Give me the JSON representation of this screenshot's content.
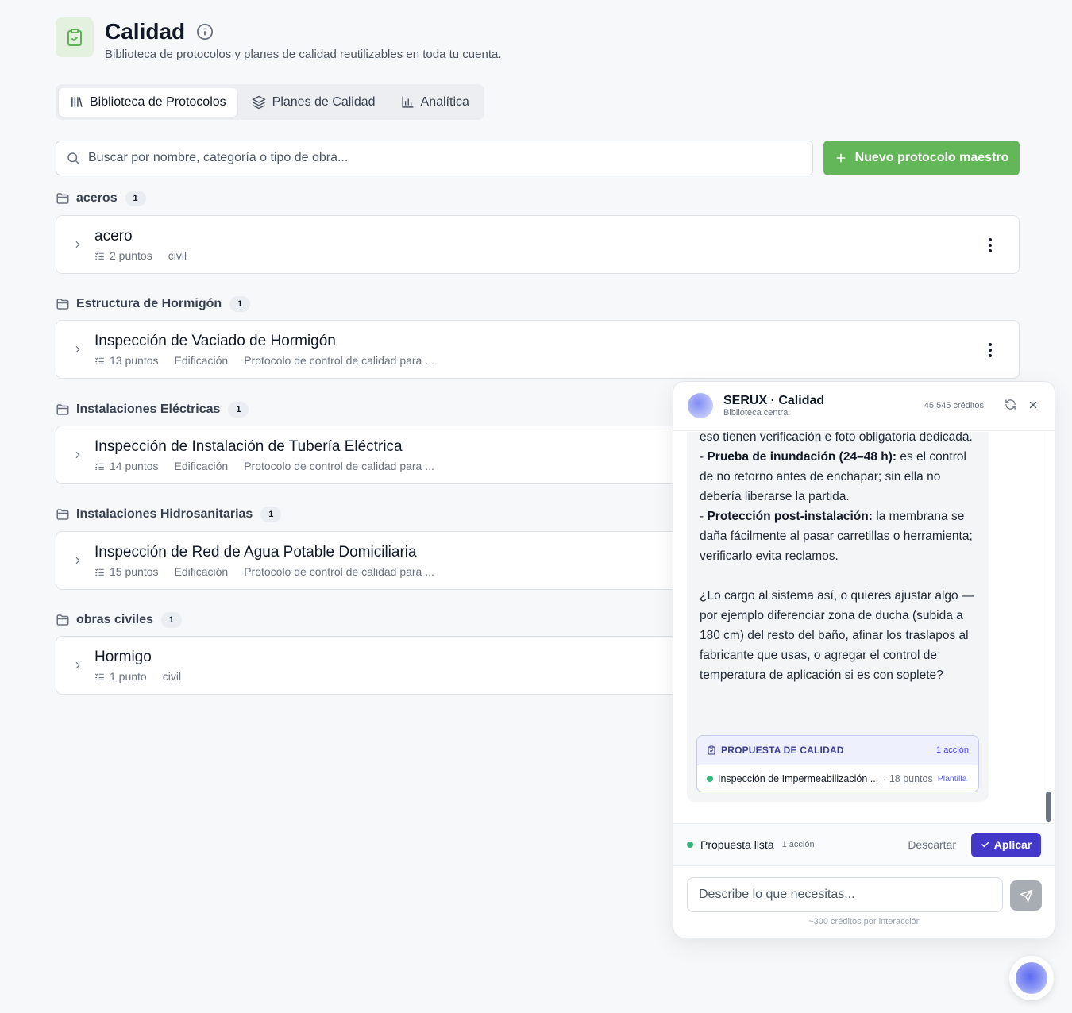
{
  "header": {
    "title": "Calidad",
    "subtitle": "Biblioteca de protocolos y planes de calidad reutilizables en toda tu cuenta."
  },
  "tabs": [
    {
      "label": "Biblioteca de Protocolos",
      "icon": "library-icon",
      "active": true
    },
    {
      "label": "Planes de Calidad",
      "icon": "layers-icon",
      "active": false
    },
    {
      "label": "Analítica",
      "icon": "bar-chart-icon",
      "active": false
    }
  ],
  "search": {
    "placeholder": "Buscar por nombre, categoría o tipo de obra..."
  },
  "new_button": {
    "label": "Nuevo protocolo maestro"
  },
  "groups": [
    {
      "name": "aceros",
      "count": "1",
      "item": {
        "title": "acero",
        "points": "2 puntos",
        "type": "civil",
        "description": ""
      }
    },
    {
      "name": "Estructura de Hormigón",
      "count": "1",
      "item": {
        "title": "Inspección de Vaciado de Hormigón",
        "points": "13 puntos",
        "type": "Edificación",
        "description": "Protocolo de control de calidad para ..."
      }
    },
    {
      "name": "Instalaciones Eléctricas",
      "count": "1",
      "item": {
        "title": "Inspección de Instalación de Tubería Eléctrica",
        "points": "14 puntos",
        "type": "Edificación",
        "description": "Protocolo de control de calidad para ..."
      }
    },
    {
      "name": "Instalaciones Hidrosanitarias",
      "count": "1",
      "item": {
        "title": "Inspección de Red de Agua Potable Domiciliaria",
        "points": "15 puntos",
        "type": "Edificación",
        "description": "Protocolo de control de calidad para ..."
      }
    },
    {
      "name": "obras civiles",
      "count": "1",
      "item": {
        "title": "Hormigo",
        "points": "1 punto",
        "type": "civil",
        "description": ""
      }
    }
  ],
  "chat": {
    "name": "SERUX · Calidad",
    "subtitle": "Biblioteca central",
    "credits": "45,545 créditos",
    "message": {
      "p1": "eso tienen verificación e foto obligatoria dedicada.",
      "b1_prefix": "- ",
      "b1_bold": "Prueba de inundación (24–48 h):",
      "b1_text": " es el control de no retorno antes de enchapar; sin ella no debería liberarse la partida.",
      "b2_prefix": "- ",
      "b2_bold": "Protección post-instalación:",
      "b2_text": " la membrana se daña fácilmente al pasar carretillas o herramienta; verificarlo evita reclamos.",
      "question": "¿Lo cargo al sistema así, o quieres ajustar algo —por ejemplo diferenciar zona de ducha (subida a 180 cm) del resto del baño, afinar los traslapos al fabricante que usas, o agregar el control de temperatura de aplicación si es con soplete?"
    },
    "proposal": {
      "title": "PROPUESTA DE CALIDAD",
      "count": "1 acción",
      "item_name": "Inspección de Impermeabilización ...",
      "item_points": "· 18 puntos",
      "item_tag": "Plantilla"
    },
    "status": {
      "label": "Propuesta lista",
      "count": "1 acción"
    },
    "discard_label": "Descartar",
    "apply_label": "Aplicar",
    "input_placeholder": "Describe lo que necesitas...",
    "hint": "~300 créditos por interacción"
  },
  "colors": {
    "accent_green": "#63b759",
    "accent_indigo": "#4338ca",
    "status_green": "#34b37a"
  }
}
